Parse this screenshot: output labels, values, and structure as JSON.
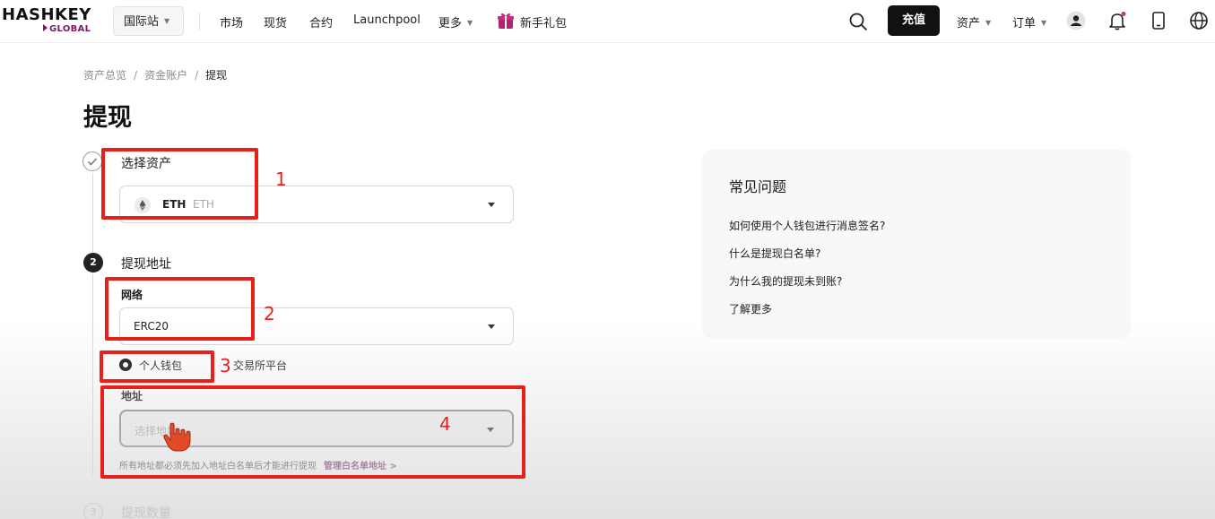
{
  "header": {
    "logo_top": "HASHKEY",
    "logo_bottom": "GLOBAL",
    "site_selector": "国际站",
    "nav": [
      "市场",
      "现货",
      "合约",
      "Launchpool",
      "更多"
    ],
    "promo": "新手礼包",
    "deposit_label": "充值",
    "assets_menu": "资产",
    "orders_menu": "订单"
  },
  "breadcrumb": [
    "资产总览",
    "资金账户",
    "提现"
  ],
  "page_title": "提现",
  "steps": {
    "step1": {
      "label": "选择资产",
      "asset_code": "ETH",
      "asset_name": "ETH"
    },
    "step2": {
      "number": "2",
      "label": "提现地址",
      "network_label": "网络",
      "network_value": "ERC20",
      "radio_selected": "个人钱包",
      "radio_other": "交易所平台",
      "address_label": "地址",
      "address_placeholder": "选择地址",
      "hint": "所有地址都必须先加入地址白名单后才能进行提现",
      "hint_link": "管理白名单地址 >"
    },
    "step3": {
      "number": "3",
      "label": "提现数量"
    }
  },
  "faq": {
    "title": "常见问题",
    "items": [
      "如何使用个人钱包进行消息签名?",
      "什么是提现白名单?",
      "为什么我的提现未到账?",
      "了解更多"
    ]
  },
  "annotations": [
    "1",
    "2",
    "3",
    "4"
  ],
  "colors": {
    "annotation_red": "#e8201c",
    "brand_purple": "#7a1a5e",
    "primary_button": "#111111"
  }
}
